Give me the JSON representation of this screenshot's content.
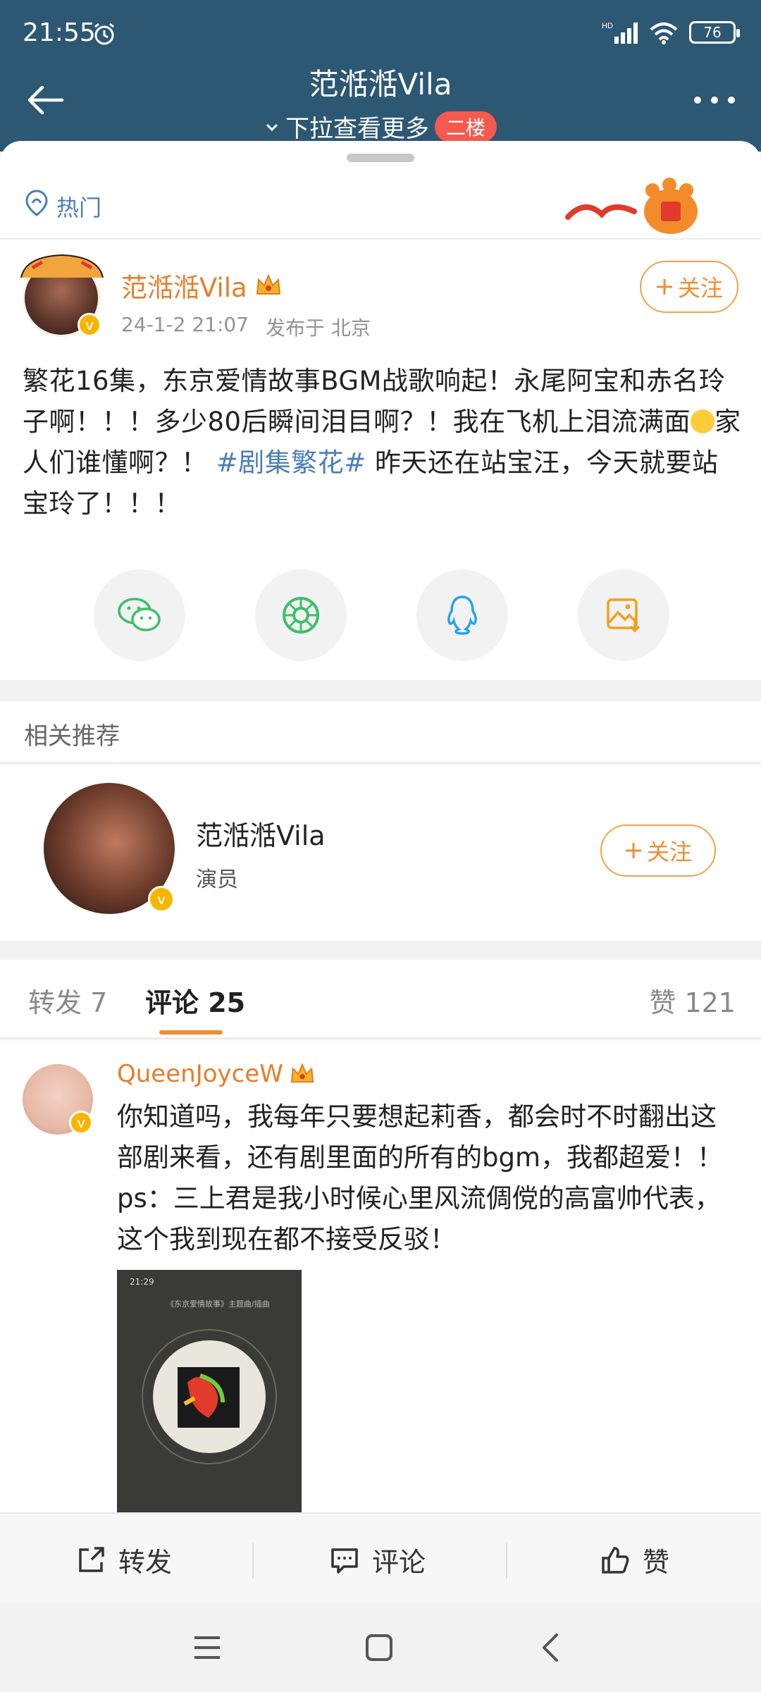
{
  "status_bar": {
    "time": "21:55",
    "network": "HD",
    "battery": "76"
  },
  "nav": {
    "title": "范湉湉Vila",
    "subtitle": "下拉查看更多",
    "badge": "二楼"
  },
  "hot": {
    "label": "热门"
  },
  "post": {
    "author": "范湉湉Vila",
    "date": "24-1-2 21:07",
    "location": "发布于 北京",
    "follow_label": "关注",
    "text_part1": "繁花16集，东京爱情故事BGM战歌响起！永尾阿宝和赤名玲子啊！！！多少80后瞬间泪目啊？！我在飞机上泪流满面",
    "text_part2": "家人们谁懂啊？！",
    "hashtag": "#剧集繁花#",
    "text_part3": " 昨天还在站宝汪，今天就要站宝玲了！！！"
  },
  "share": [
    "wechat-icon",
    "moments-icon",
    "qq-icon",
    "save-image-icon"
  ],
  "related": {
    "title": "相关推荐",
    "name": "范湉湉Vila",
    "role": "演员",
    "follow_label": "关注"
  },
  "tabs": {
    "repost": "转发 7",
    "comments": "评论 25",
    "likes": "赞 121"
  },
  "comment": {
    "author": "QueenJoyceW",
    "text": "你知道吗，我每年只要想起莉香，都会时不时翻出这部剧来看，还有剧里面的所有的bgm，我都超爱！！ps：三上君是我小时候心里风流倜傥的高富帅代表，这个我到现在都不接受反驳！",
    "image_time": "21:29",
    "image_title": "《东京爱情故事》主题曲/插曲"
  },
  "bottom_bar": {
    "repost": "转发",
    "comment": "评论",
    "like": "赞"
  },
  "colors": {
    "header": "#2d5874",
    "accent": "#f08e34",
    "link": "#4a7fb5",
    "vip": "#f7b500"
  }
}
